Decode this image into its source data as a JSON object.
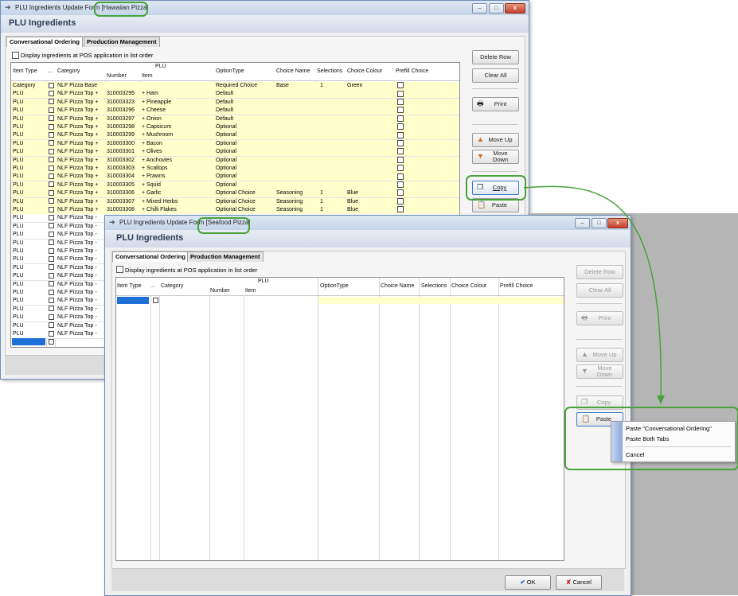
{
  "back_window": {
    "title": "PLU Ingredients Update Form",
    "title_suffix": "[Hawaiian Pizza]",
    "header": "PLU Ingredients",
    "tabs": [
      "Conversational Ordering",
      "Production Management"
    ],
    "display_checkbox_label": "Display ingredients at POS application in list order",
    "columns": {
      "item_type": "Item Type",
      "dots": "...",
      "category": "Category",
      "plu": "PLU",
      "number": "Number",
      "item": "Item",
      "option_type": "OptionType",
      "choice_name": "Choice Name",
      "selections": "Selections",
      "choice_colour": "Choice Colour",
      "prefill": "Prefill Choice"
    },
    "rows": [
      {
        "type": "Category",
        "cat": "NLF Pizza Base",
        "num": "",
        "item": "",
        "opt": "Required Choice",
        "cname": "Base",
        "sel": "1",
        "col": "Green"
      },
      {
        "type": "PLU",
        "cat": "NLF Pizza Top +",
        "num": "310003295",
        "item": "+ Ham",
        "opt": "Default",
        "cname": "",
        "sel": "",
        "col": ""
      },
      {
        "type": "PLU",
        "cat": "NLF Pizza Top +",
        "num": "310003323",
        "item": "+ Pineapple",
        "opt": "Default",
        "cname": "",
        "sel": "",
        "col": ""
      },
      {
        "type": "PLU",
        "cat": "NLF Pizza Top +",
        "num": "310003296",
        "item": "+ Cheese",
        "opt": "Default",
        "cname": "",
        "sel": "",
        "col": ""
      },
      {
        "type": "PLU",
        "cat": "NLF Pizza Top +",
        "num": "310003297",
        "item": "+ Onion",
        "opt": "Default",
        "cname": "",
        "sel": "",
        "col": ""
      },
      {
        "type": "PLU",
        "cat": "NLF Pizza Top +",
        "num": "310003298",
        "item": "+ Capsicum",
        "opt": "Optional",
        "cname": "",
        "sel": "",
        "col": ""
      },
      {
        "type": "PLU",
        "cat": "NLF Pizza Top +",
        "num": "310003299",
        "item": "+ Mushroom",
        "opt": "Optional",
        "cname": "",
        "sel": "",
        "col": ""
      },
      {
        "type": "PLU",
        "cat": "NLF Pizza Top +",
        "num": "310003300",
        "item": "+ Bacon",
        "opt": "Optional",
        "cname": "",
        "sel": "",
        "col": ""
      },
      {
        "type": "PLU",
        "cat": "NLF Pizza Top +",
        "num": "310003301",
        "item": "+ Olives",
        "opt": "Optional",
        "cname": "",
        "sel": "",
        "col": ""
      },
      {
        "type": "PLU",
        "cat": "NLF Pizza Top +",
        "num": "310003302",
        "item": "+ Anchovies",
        "opt": "Optional",
        "cname": "",
        "sel": "",
        "col": ""
      },
      {
        "type": "PLU",
        "cat": "NLF Pizza Top +",
        "num": "310003303",
        "item": "+ Scallops",
        "opt": "Optional",
        "cname": "",
        "sel": "",
        "col": ""
      },
      {
        "type": "PLU",
        "cat": "NLF Pizza Top +",
        "num": "310003304",
        "item": "+ Prawns",
        "opt": "Optional",
        "cname": "",
        "sel": "",
        "col": ""
      },
      {
        "type": "PLU",
        "cat": "NLF Pizza Top +",
        "num": "310003305",
        "item": "+ Squid",
        "opt": "Optional",
        "cname": "",
        "sel": "",
        "col": ""
      },
      {
        "type": "PLU",
        "cat": "NLF Pizza Top +",
        "num": "310003306",
        "item": "+ Garlic",
        "opt": "Optional Choice",
        "cname": "Seasoning",
        "sel": "1",
        "col": "Blue"
      },
      {
        "type": "PLU",
        "cat": "NLF Pizza Top +",
        "num": "310003307",
        "item": "+ Mixed Herbs",
        "opt": "Optional Choice",
        "cname": "Seasoning",
        "sel": "1",
        "col": "Blue"
      },
      {
        "type": "PLU",
        "cat": "NLF Pizza Top +",
        "num": "310003308",
        "item": "+ Chilli Flakes",
        "opt": "Optional Choice",
        "cname": "Seasoning",
        "sel": "1",
        "col": "Blue"
      },
      {
        "type": "PLU",
        "cat": "NLF Pizza Top -",
        "num": "",
        "item": "",
        "opt": "",
        "cname": "",
        "sel": "",
        "col": ""
      },
      {
        "type": "PLU",
        "cat": "NLF Pizza Top -",
        "num": "",
        "item": "",
        "opt": "",
        "cname": "",
        "sel": "",
        "col": ""
      },
      {
        "type": "PLU",
        "cat": "NLF Pizza Top -",
        "num": "",
        "item": "",
        "opt": "",
        "cname": "",
        "sel": "",
        "col": ""
      },
      {
        "type": "PLU",
        "cat": "NLF Pizza Top -",
        "num": "",
        "item": "",
        "opt": "",
        "cname": "",
        "sel": "",
        "col": ""
      },
      {
        "type": "PLU",
        "cat": "NLF Pizza Top -",
        "num": "",
        "item": "",
        "opt": "",
        "cname": "",
        "sel": "",
        "col": ""
      },
      {
        "type": "PLU",
        "cat": "NLF Pizza Top -",
        "num": "",
        "item": "",
        "opt": "",
        "cname": "",
        "sel": "",
        "col": ""
      },
      {
        "type": "PLU",
        "cat": "NLF Pizza Top -",
        "num": "",
        "item": "",
        "opt": "",
        "cname": "",
        "sel": "",
        "col": ""
      },
      {
        "type": "PLU",
        "cat": "NLF Pizza Top -",
        "num": "",
        "item": "",
        "opt": "",
        "cname": "",
        "sel": "",
        "col": ""
      },
      {
        "type": "PLU",
        "cat": "NLF Pizza Top -",
        "num": "",
        "item": "",
        "opt": "",
        "cname": "",
        "sel": "",
        "col": ""
      },
      {
        "type": "PLU",
        "cat": "NLF Pizza Top -",
        "num": "",
        "item": "",
        "opt": "",
        "cname": "",
        "sel": "",
        "col": ""
      },
      {
        "type": "PLU",
        "cat": "NLF Pizza Top -",
        "num": "",
        "item": "",
        "opt": "",
        "cname": "",
        "sel": "",
        "col": ""
      },
      {
        "type": "PLU",
        "cat": "NLF Pizza Top -",
        "num": "",
        "item": "",
        "opt": "",
        "cname": "",
        "sel": "",
        "col": ""
      },
      {
        "type": "PLU",
        "cat": "NLF Pizza Top -",
        "num": "",
        "item": "",
        "opt": "",
        "cname": "",
        "sel": "",
        "col": ""
      },
      {
        "type": "PLU",
        "cat": "NLF Pizza Top -",
        "num": "",
        "item": "",
        "opt": "",
        "cname": "",
        "sel": "",
        "col": ""
      },
      {
        "type": "PLU",
        "cat": "NLF Pizza Top -",
        "num": "",
        "item": "",
        "opt": "",
        "cname": "",
        "sel": "",
        "col": ""
      }
    ],
    "buttons": {
      "delete_row": "Delete Row",
      "clear_all": "Clear All",
      "print": "Print",
      "move_up": "Move Up",
      "move_down": "Move Down",
      "copy": "Copy",
      "paste": "Paste"
    }
  },
  "front_window": {
    "title": "PLU Ingredients Update Form",
    "title_suffix": "[Seafood Pizza]",
    "header": "PLU Ingredients",
    "tabs": [
      "Conversational Ordering",
      "Production Management"
    ],
    "display_checkbox_label": "Display ingredients at POS application in list order",
    "columns": {
      "item_type": "Item Type",
      "dots": "...",
      "category": "Category",
      "plu": "PLU",
      "number": "Number",
      "item": "Item",
      "option_type": "OptionType",
      "choice_name": "Choice Name",
      "selections": "Selections",
      "choice_colour": "Choice Colour",
      "prefill": "Prefill Choice"
    },
    "buttons": {
      "delete_row": "Delete Row",
      "clear_all": "Clear All",
      "print": "Print",
      "move_up": "Move Up",
      "move_down": "Move Down",
      "copy": "Copy",
      "paste": "Paste",
      "ok": "OK",
      "cancel": "Cancel"
    },
    "paste_menu": [
      "Paste \"Conversational Ordering\"",
      "Paste Both Tabs",
      "Cancel"
    ]
  },
  "window_controls": {
    "minimize": "–",
    "maximize": "□",
    "close": "x"
  },
  "colors": {
    "highlight_green": "#4aa23b",
    "row_yellow": "#ffffcc",
    "selection_blue": "#1e6fd6"
  }
}
